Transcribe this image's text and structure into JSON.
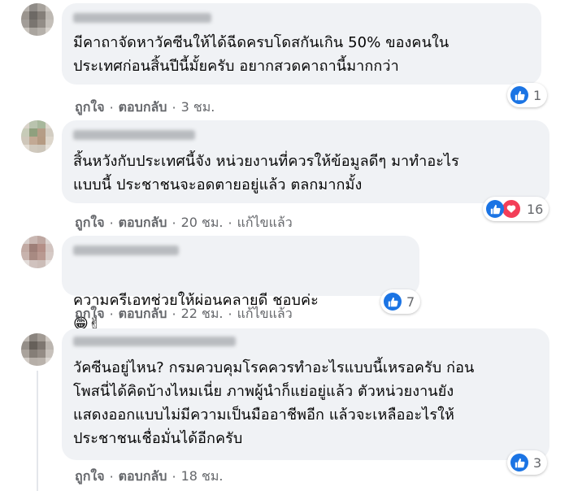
{
  "comments": [
    {
      "text": "มีคาถาจัดหาวัคซีนให้ได้ฉีดครบโดสกันเกิน 50% ของคนใน\nประเทศก่อนสิ้นปีนี้มั้ยครับ อยากสวดคาถานี้มากกว่า",
      "like_label": "ถูกใจ",
      "reply_label": "ตอบกลับ",
      "time": "3 ชม.",
      "reaction_count": "1"
    },
    {
      "text": "สิ้นหวังกับประเทศนี้จัง หน่วยงานที่ควรให้ข้อมูลดีๆ มาทำอะไร\nแบบนี้ ประชาชนจะอดตายอยู่แล้ว ตลกมากมั้ง",
      "like_label": "ถูกใจ",
      "reply_label": "ตอบกลับ",
      "time": "20 ชม.",
      "edited": "แก้ไขแล้ว",
      "reaction_count": "16"
    },
    {
      "text": "ความครีเอทช่วยให้ผ่อนคลายดี ชอบค่ะ",
      "emoji": "😁✌",
      "like_label": "ถูกใจ",
      "reply_label": "ตอบกลับ",
      "time": "22 ชม.",
      "edited": "แก้ไขแล้ว",
      "reaction_count": "7"
    },
    {
      "text": "วัคซีนอยู่ไหน? กรมควบคุมโรคควรทำอะไรแบบนี้เหรอครับ ก่อน\nโพสนี่ได้คิดบ้างไหมเนี่ย ภาพผู้นำก็แย่อยู่แล้ว ตัวหน่วยงานยัง\nแสดงออกแบบไม่มีความเป็นมืออาชีพอีก แล้วจะเหลืออะไรให้\nประชาชนเชื่อมั่นได้อีกครับ",
      "like_label": "ถูกใจ",
      "reply_label": "ตอบกลับ",
      "time": "18 ชม.",
      "reaction_count": "3"
    }
  ],
  "separator": "·",
  "colors": {
    "like_blue": "#1b74e4",
    "heart_red": "#f33e58",
    "bubble": "#f0f2f5"
  },
  "icons": [
    "like-icon",
    "heart-icon"
  ]
}
